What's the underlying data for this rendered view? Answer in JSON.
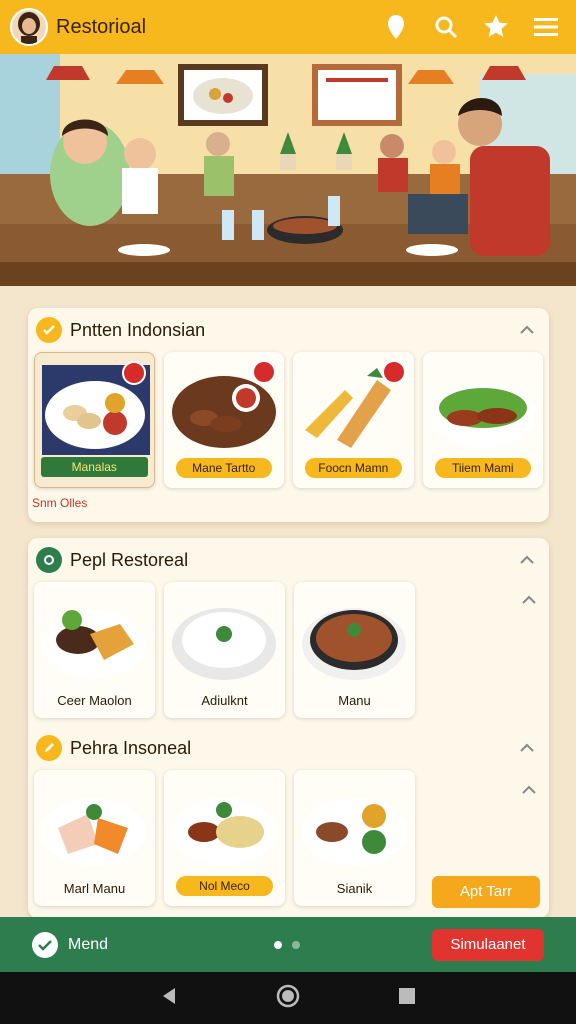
{
  "header": {
    "title": "Restorioal",
    "icons": [
      "pin-icon",
      "search-icon",
      "star-icon",
      "menu-icon"
    ]
  },
  "section1": {
    "title": "Pntten Indonsian",
    "items": [
      {
        "label": "Manalas",
        "selected": true
      },
      {
        "label": "Mane Tartto"
      },
      {
        "label": "Foocn Mamn"
      },
      {
        "label": "Tiiem Mami"
      }
    ],
    "hint": "Snm Olles"
  },
  "section2": {
    "title": "Pepl Restoreal",
    "items": [
      {
        "label": "Ceer Maolon"
      },
      {
        "label": "Adiulknt"
      },
      {
        "label": "Manu"
      }
    ]
  },
  "section3": {
    "title": "Pehra Insoneal",
    "items": [
      {
        "label": "Marl Manu"
      },
      {
        "label": "Nol Meco"
      },
      {
        "label": "Sianik"
      }
    ],
    "cta": "Apt Tarr"
  },
  "bottom": {
    "menu_label": "Mend",
    "action_label": "Simulaanet"
  },
  "colors": {
    "accent": "#f6b81c",
    "green": "#2e7d4f",
    "red": "#e2342f"
  }
}
